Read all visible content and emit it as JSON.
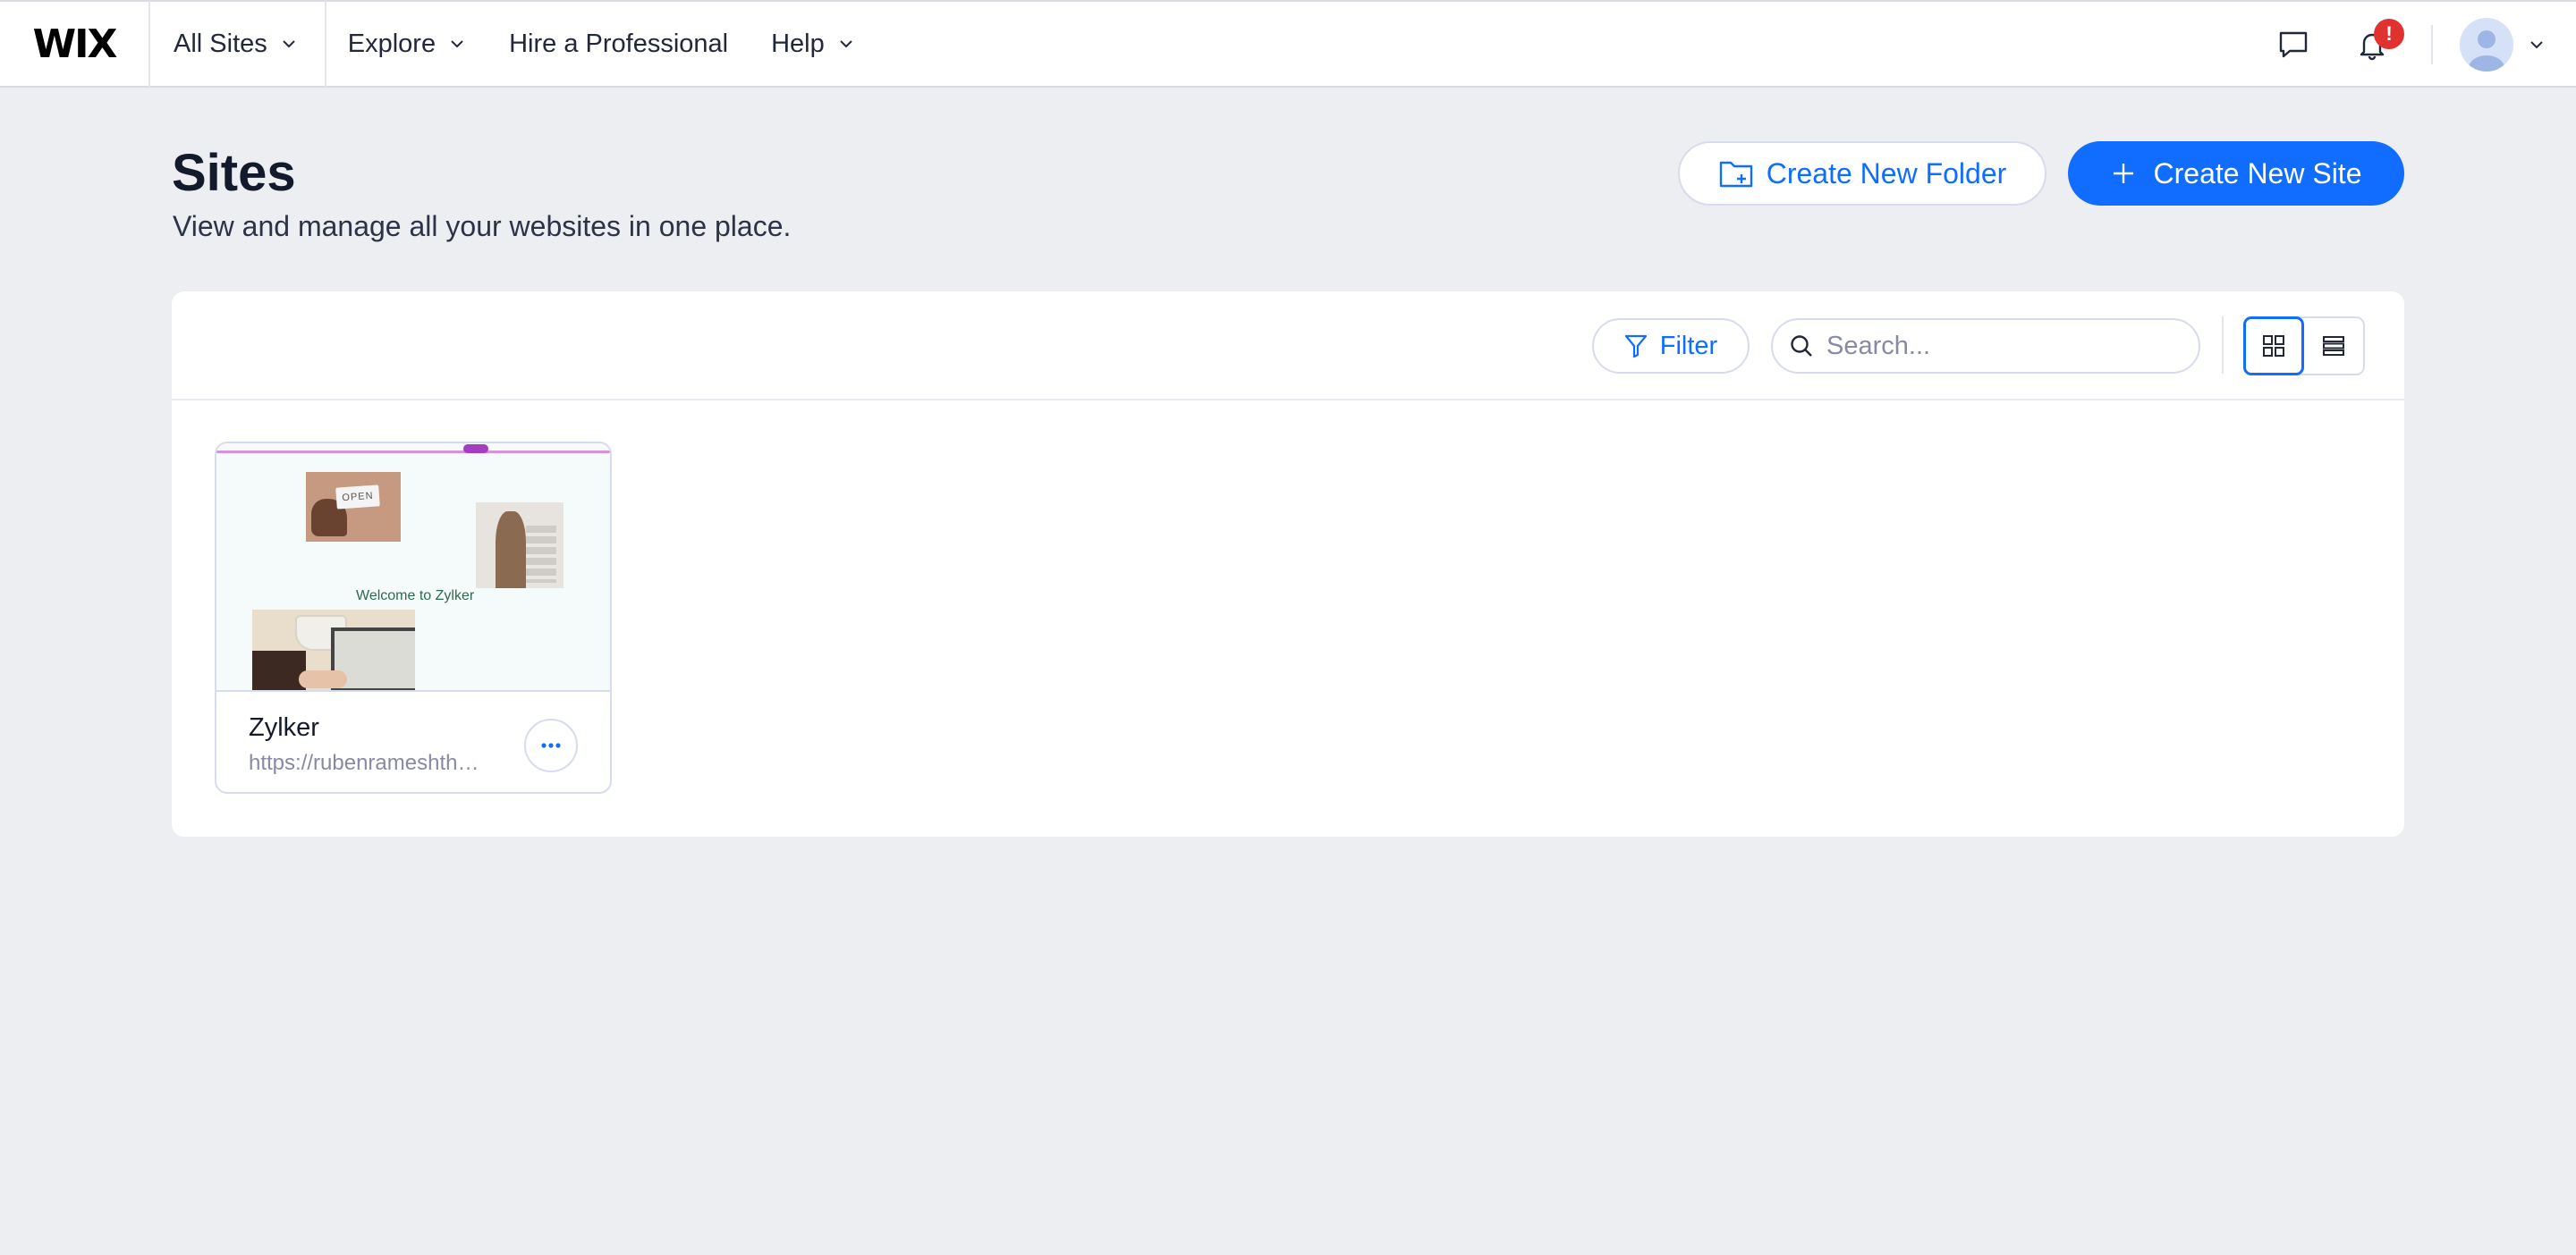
{
  "topbar": {
    "logo": "WIX",
    "nav": [
      {
        "label": "All Sites"
      },
      {
        "label": "Explore"
      },
      {
        "label": "Hire a Professional"
      },
      {
        "label": "Help"
      }
    ],
    "notifications_badge": "!"
  },
  "header": {
    "title": "Sites",
    "subtitle": "View and manage all your websites in one place.",
    "create_folder_label": "Create New Folder",
    "create_site_label": "Create New Site"
  },
  "toolbar": {
    "filter_label": "Filter",
    "search_placeholder": "Search...",
    "view_mode": "grid"
  },
  "sites": [
    {
      "name": "Zylker",
      "url": "https://rubenrameshthreelinks.wixsite.com/zylker",
      "thumbnail": {
        "sign_text": "OPEN",
        "welcome_text": "Welcome to Zylker"
      }
    }
  ],
  "colors": {
    "accent": "#116dff",
    "background": "#eceef2",
    "badge": "#e0322f"
  },
  "icons": [
    "chat-icon",
    "bell-icon",
    "avatar-icon",
    "folder-plus-icon",
    "plus-icon",
    "filter-icon",
    "search-icon",
    "grid-view-icon",
    "list-view-icon",
    "more-icon"
  ]
}
